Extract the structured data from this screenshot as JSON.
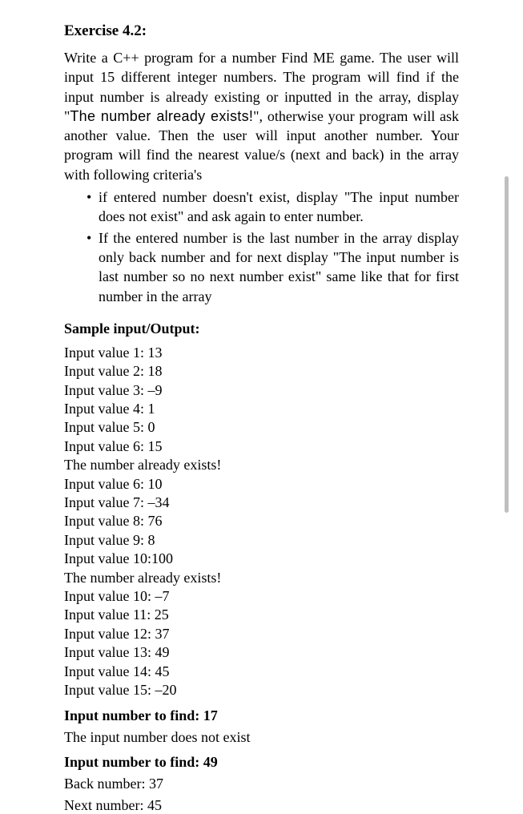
{
  "exercise": {
    "title": "Exercise 4.2:",
    "description_pre": "Write a C++ program for a number Find ME game. The user will input 15 different integer numbers. The program will find if the input number is already existing or inputted in the array, display \"",
    "description_mono": "The number already exists!",
    "description_post": "\", otherwise your program will ask another value. Then the user will input another number. Your program will find the nearest value/s (next and back) in the array with following criteria's",
    "bullets": [
      "if entered number doesn't exist, display \"The input number does not exist\" and ask again to enter number.",
      "If the entered number is the last number in the array display only back number and for next display \"The input number is last number so no next number exist\" same like that for first number in the array"
    ]
  },
  "sample": {
    "heading": "Sample input/Output:",
    "io_lines": [
      "Input value 1: 13",
      "Input value 2: 18",
      "Input value 3: –9",
      "Input value 4: 1",
      "Input value 5: 0",
      "Input value 6: 15",
      "The number already exists!",
      "Input value 6: 10",
      "Input value 7: –34",
      "Input value 8: 76",
      "Input value 9: 8",
      "Input value 10:100",
      "The number already exists!",
      "Input value 10: –7",
      "Input value 11: 25",
      "Input value 12: 37",
      "Input value 13: 49",
      "Input value 14: 45",
      "Input value 15: –20"
    ],
    "find1": "Input number to find: 17",
    "result1": "The input number does not exist",
    "find2": "Input number to find: 49",
    "back": "Back number: 37",
    "next": "Next number: 45"
  }
}
